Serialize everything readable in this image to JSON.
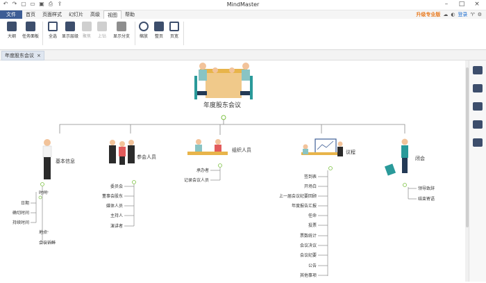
{
  "app": {
    "title": "MindMaster"
  },
  "quick_access": [
    "undo-icon",
    "redo-icon",
    "new-icon",
    "open-icon",
    "save-icon",
    "print-icon",
    "export-icon"
  ],
  "menu": {
    "file": "文件",
    "items": [
      "首页",
      "页面样式",
      "幻灯片",
      "高级",
      "视图",
      "帮助"
    ]
  },
  "account": {
    "upgrade": "升级专业版",
    "login": "登录"
  },
  "ribbon": [
    {
      "label": "大纲",
      "disabled": false
    },
    {
      "label": "任务面板",
      "disabled": false
    },
    {
      "label": "全选",
      "disabled": false
    },
    {
      "label": "显示层级",
      "disabled": false
    },
    {
      "label": "聚焦",
      "disabled": true
    },
    {
      "label": "上钻",
      "disabled": true
    },
    {
      "label": "显示分支",
      "disabled": false
    },
    {
      "label": "缩放",
      "disabled": false
    },
    {
      "label": "整页",
      "disabled": false
    },
    {
      "label": "页宽",
      "disabled": false
    }
  ],
  "document_tab": {
    "label": "年度股东会议",
    "close": "×"
  },
  "mindmap": {
    "root": "年度股东会议",
    "branches": [
      {
        "label": "基本信息",
        "items": [
          "时间",
          "日期",
          "确切时间",
          "持续时间",
          "地点",
          "会议诉醉"
        ]
      },
      {
        "label": "参会人员",
        "items": [
          "委员会",
          "董事会股东",
          "媒体人员",
          "主持人",
          "演讲者"
        ]
      },
      {
        "label": "组织人员",
        "items": [
          "承办者",
          "记录会议人员"
        ]
      },
      {
        "label": "议程",
        "items": [
          "签到表",
          "开场白",
          "上一届会议纪要回顾",
          "年度报告汇报",
          "任命",
          "投票",
          "票数统计",
          "会议决议",
          "会议纪要",
          "公告",
          "其他事项"
        ]
      },
      {
        "label": "闭会",
        "items": [
          "领导致辞",
          "结束寄语"
        ]
      }
    ]
  },
  "colors": {
    "accent": "#3d5d95",
    "line": "#8a8a8a",
    "collapse": "#7cc242"
  }
}
